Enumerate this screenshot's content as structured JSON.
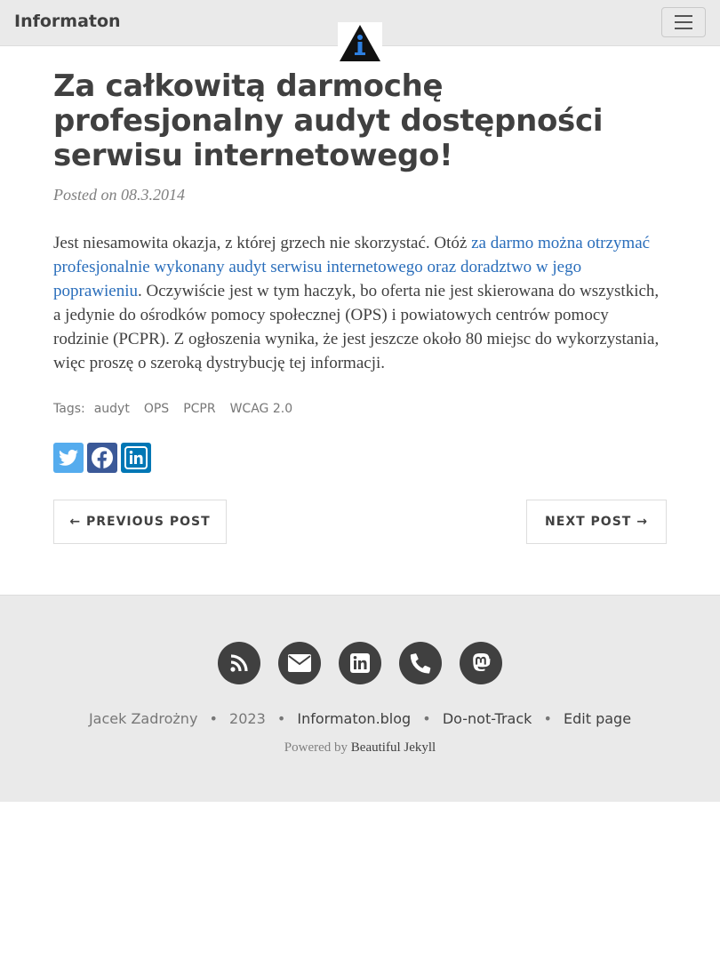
{
  "navbar": {
    "brand": "Informaton",
    "menu_icon": "hamburger-menu-icon",
    "logo_icon": "informaton-logo-icon"
  },
  "post": {
    "title": "Za całkowitą darmochę profesjonalny audyt dostępności serwisu internetowego!",
    "posted_prefix": "Posted on ",
    "posted_date": "08.3.2014",
    "body_before": "Jest niesamowita okazja, z której grzech nie skorzystać. Otóż ",
    "body_link": "za darmo można otrzymać profesjonalnie wykonany audyt serwisu internetowego oraz doradztwo w jego poprawieniu",
    "body_after": ". Oczywiście jest w tym haczyk, bo oferta nie jest skierowana do wszystkich, a jedynie do ośrodków pomocy społecznej (OPS) i powiatowych centrów pomocy rodzinie (PCPR). Z ogłoszenia wynika, że jest jeszcze około 80 miejsc do wykorzystania, więc proszę o szeroką dystrybucję tej informacji.",
    "tags_label": "Tags:",
    "tags": [
      "audyt",
      "OPS",
      "PCPR",
      "WCAG 2.0"
    ],
    "share": [
      {
        "icon": "twitter-icon",
        "color": "#55acee"
      },
      {
        "icon": "facebook-icon",
        "color": "#3b5998"
      },
      {
        "icon": "linkedin-icon",
        "color": "#0077b5"
      }
    ],
    "prev_label": "← PREVIOUS POST",
    "next_label": "NEXT POST →"
  },
  "footer": {
    "icons": [
      "rss-icon",
      "envelope-icon",
      "linkedin-icon",
      "phone-icon",
      "mastodon-icon"
    ],
    "author": "Jacek Zadrożny",
    "year": "2023",
    "links": [
      "Informaton.blog",
      "Do-not-Track",
      "Edit page"
    ],
    "separator": "•",
    "powered_prefix": "Powered by ",
    "powered_link": "Beautiful Jekyll"
  },
  "colors": {
    "link": "#2a6ebb",
    "navbar_bg": "#eaeaea",
    "footer_bg": "#eaeaea",
    "text": "#404040"
  }
}
